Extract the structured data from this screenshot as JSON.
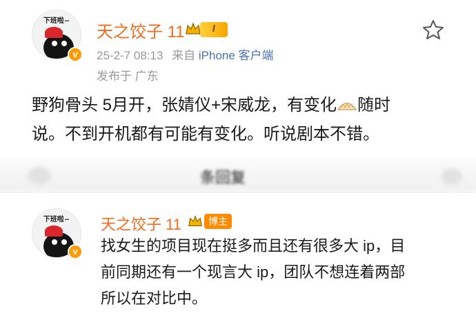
{
  "post": {
    "avatar_caption": "下班啦~",
    "username": "天之饺子 11",
    "level_badge": "I",
    "timestamp": "25-2-7 08:13",
    "source_prefix": "来自",
    "source_device": "iPhone 客户端",
    "location": "发布于 广东",
    "body_line1_a": "野狗骨头 5月开，张婧仪+宋威龙，有变化",
    "body_line1_b": "随时",
    "body_line2": "说。不到开机都有可能有变化。听说剧本不错。",
    "emoji_name": "dumpling-emoji",
    "favorite_icon": "star-outline-icon"
  },
  "collapsed_bar": {
    "text": "条回复"
  },
  "comment": {
    "avatar_caption": "下班啦~",
    "username": "天之饺子 11",
    "host_badge": "博主",
    "text_line1": "找女生的项目现在挺多而且还有很多大 ip，目",
    "text_line2": "前同期还有一个现言大 ip，团队不想连着两部",
    "text_line3": "所以在对比中。"
  },
  "colors": {
    "username": "#f26b1d",
    "meta": "#9a9a9a",
    "verified_badge": "#ff9a00",
    "host_badge": "#ff8a00"
  }
}
